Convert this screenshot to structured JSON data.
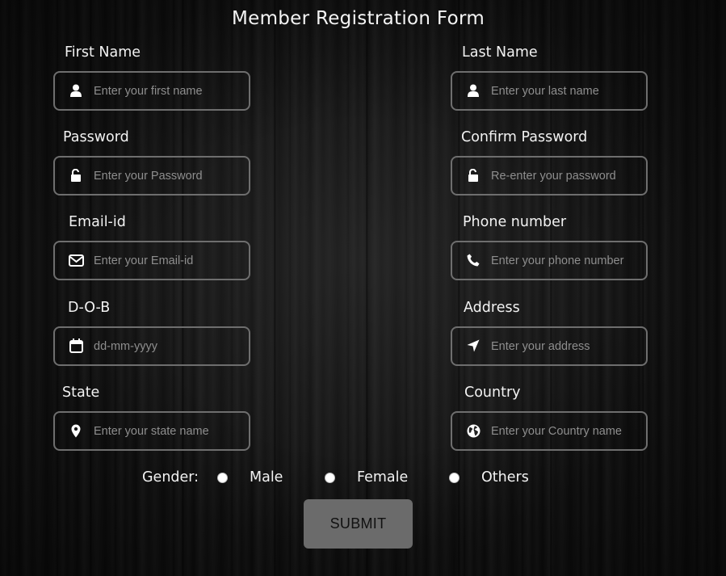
{
  "form": {
    "title": "Member Registration Form",
    "fields": [
      {
        "label": "First Name",
        "placeholder": "Enter your first name",
        "icon": "user-icon"
      },
      {
        "label": "Last Name",
        "placeholder": "Enter your last name",
        "icon": "user-icon"
      },
      {
        "label": "Password",
        "placeholder": "Enter your Password",
        "icon": "unlock-icon"
      },
      {
        "label": "Confirm Password",
        "placeholder": "Re-enter your password",
        "icon": "unlock-icon"
      },
      {
        "label": "Email-id",
        "placeholder": "Enter your Email-id",
        "icon": "envelope-icon"
      },
      {
        "label": "Phone number",
        "placeholder": "Enter your phone number",
        "icon": "phone-icon"
      },
      {
        "label": "D-O-B",
        "placeholder": "dd-mm-yyyy",
        "icon": "calendar-icon"
      },
      {
        "label": "Address",
        "placeholder": "Enter your address",
        "icon": "location-arrow-icon"
      },
      {
        "label": "State",
        "placeholder": "Enter your state name",
        "icon": "map-pin-icon"
      },
      {
        "label": "Country",
        "placeholder": "Enter your Country name",
        "icon": "globe-icon"
      }
    ],
    "gender": {
      "label": "Gender:",
      "options": [
        "Male",
        "Female",
        "Others"
      ]
    },
    "submit_label": "SUBMIT"
  },
  "colors": {
    "field_border": "#6e6e6e",
    "button_bg": "#6b6b6b",
    "text": "#f2f2f2"
  }
}
